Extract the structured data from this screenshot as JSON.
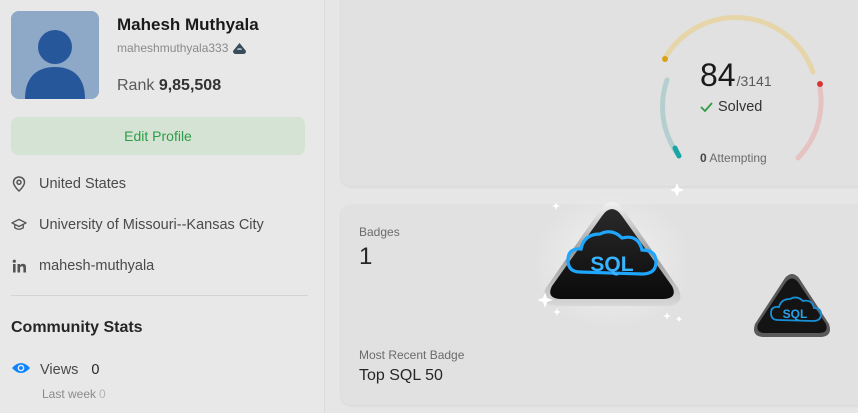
{
  "profile": {
    "name": "Mahesh Muthyala",
    "username": "maheshmuthyala333",
    "rank_label": "Rank",
    "rank_value": "9,85,508",
    "edit_button": "Edit Profile",
    "location": "United States",
    "school": "University of Missouri--Kansas City",
    "linkedin": "mahesh-muthyala"
  },
  "community": {
    "title": "Community Stats",
    "views_label": "Views",
    "views_value": "0",
    "last_week_label": "Last week",
    "last_week_value": "0"
  },
  "progress": {
    "solved": "84",
    "total": "/3141",
    "solved_label": "Solved",
    "attempting_count": "0",
    "attempting_label": "Attempting",
    "ring_colors": {
      "easy": "#1cb8b8",
      "medium": "#ffb700",
      "hard": "#f63737"
    }
  },
  "badges": {
    "label": "Badges",
    "count": "1",
    "recent_label": "Most Recent Badge",
    "recent_name": "Top SQL 50",
    "badge_text": "SQL"
  },
  "colors": {
    "accent_green": "#2e9d46",
    "views_blue": "#0a84ff"
  }
}
